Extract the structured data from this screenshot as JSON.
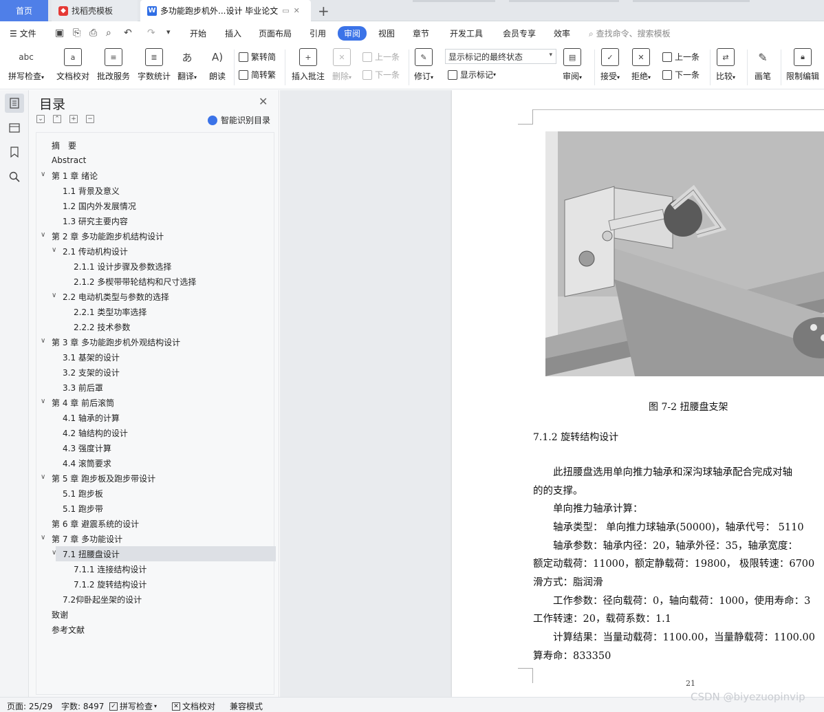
{
  "tabs": {
    "home": "首页",
    "template": "找稻壳模板",
    "document": "多功能跑步机外...设计 毕业论文",
    "add": "+"
  },
  "menu": {
    "file": "文件",
    "items": [
      "开始",
      "插入",
      "页面布局",
      "引用",
      "审阅",
      "视图",
      "章节",
      "开发工具",
      "会员专享",
      "效率"
    ],
    "active": "审阅",
    "search": "查找命令、搜索模板"
  },
  "ribbon": {
    "spell_check": "拼写检查",
    "doc_check": "文档校对",
    "revise_service": "批改服务",
    "word_count": "字数统计",
    "translate": "翻译",
    "read_aloud": "朗读",
    "to_traditional": "繁转简",
    "to_simplified": "简转繁",
    "insert_comment": "插入批注",
    "delete": "删除",
    "prev_comment": "上一条",
    "next_comment": "下一条",
    "track_changes": "修订",
    "markup_state": "显示标记的最终状态",
    "show_markup": "显示标记",
    "review": "审阅",
    "accept": "接受",
    "reject": "拒绝",
    "prev_change": "上一条",
    "next_change": "下一条",
    "compare": "比较",
    "pen": "画笔",
    "restrict_edit": "限制编辑"
  },
  "toc": {
    "title": "目录",
    "smart_btn": "智能识别目录",
    "items": [
      {
        "text": "摘　要",
        "level": 0,
        "chev": ""
      },
      {
        "text": "Abstract",
        "level": 0,
        "chev": ""
      },
      {
        "text": "第 1 章  绪论",
        "level": 0,
        "chev": "∨"
      },
      {
        "text": "1.1 背景及意义",
        "level": 1,
        "chev": ""
      },
      {
        "text": "1.2 国内外发展情况",
        "level": 1,
        "chev": ""
      },
      {
        "text": "1.3 研究主要内容",
        "level": 1,
        "chev": ""
      },
      {
        "text": "第 2 章  多功能跑步机结构设计",
        "level": 0,
        "chev": "∨"
      },
      {
        "text": "2.1  传动机构设计",
        "level": 1,
        "chev": "∨"
      },
      {
        "text": "2.1.1  设计步骤及参数选择",
        "level": 2,
        "chev": ""
      },
      {
        "text": "2.1.2 多楔带带轮结构和尺寸选择",
        "level": 2,
        "chev": ""
      },
      {
        "text": "2.2  电动机类型与参数的选择",
        "level": 1,
        "chev": "∨"
      },
      {
        "text": "2.2.1 类型功率选择",
        "level": 2,
        "chev": ""
      },
      {
        "text": "2.2.2 技术参数",
        "level": 2,
        "chev": ""
      },
      {
        "text": "第 3 章  多功能跑步机外观结构设计",
        "level": 0,
        "chev": "∨"
      },
      {
        "text": "3.1 基架的设计",
        "level": 1,
        "chev": ""
      },
      {
        "text": "3.2 支架的设计",
        "level": 1,
        "chev": ""
      },
      {
        "text": "3.3 前后罩",
        "level": 1,
        "chev": ""
      },
      {
        "text": "第 4 章  前后滚筒",
        "level": 0,
        "chev": "∨"
      },
      {
        "text": "4.1 轴承的计算",
        "level": 1,
        "chev": ""
      },
      {
        "text": "4.2 轴结构的设计",
        "level": 1,
        "chev": ""
      },
      {
        "text": "4.3 强度计算",
        "level": 1,
        "chev": ""
      },
      {
        "text": "4.4 滚筒要求",
        "level": 1,
        "chev": ""
      },
      {
        "text": "第 5 章  跑步板及跑步带设计",
        "level": 0,
        "chev": "∨"
      },
      {
        "text": "5.1 跑步板",
        "level": 1,
        "chev": ""
      },
      {
        "text": "5.1 跑步带",
        "level": 1,
        "chev": ""
      },
      {
        "text": "第 6 章  避震系统的设计",
        "level": 0,
        "chev": ""
      },
      {
        "text": "第 7 章  多功能设计",
        "level": 0,
        "chev": "∨"
      },
      {
        "text": "7.1 扭腰盘设计",
        "level": 1,
        "chev": "∨"
      },
      {
        "text": "7.1.1 连接结构设计",
        "level": 2,
        "chev": ""
      },
      {
        "text": "7.1.2 旋转结构设计",
        "level": 2,
        "chev": ""
      },
      {
        "text": "7.2仰卧起坐架的设计",
        "level": 1,
        "chev": ""
      },
      {
        "text": "致谢",
        "level": 0,
        "chev": ""
      },
      {
        "text": "参考文献",
        "level": 0,
        "chev": ""
      }
    ],
    "selected_index": 27
  },
  "document": {
    "caption": "图 7-2   扭腰盘支架",
    "heading": "7.1.2 旋转结构设计",
    "lines": [
      "　　此扭腰盘选用单向推力轴承和深沟球轴承配合完成对轴",
      "的的支撑。",
      "　　单向推力轴承计算：",
      "　　轴承类型：  单向推力球轴承(50000)，轴承代号：  5110",
      "　　轴承参数：轴承内径：20，轴承外径：35，轴承宽度：",
      "额定动载荷：11000，额定静载荷：19800，  极限转速：6700",
      "滑方式：脂润滑",
      "　　工作参数：径向载荷：0，轴向载荷：1000，使用寿命：3",
      "工作转速：20，载荷系数：1.1",
      "　　计算结果：当量动载荷：1100.00，当量静载荷：1100.00",
      "算寿命：833350"
    ],
    "page_number": "21"
  },
  "status": {
    "page": "页面: 25/29",
    "words": "字数: 8497",
    "spell": "拼写检查",
    "proof": "文档校对",
    "compat": "兼容模式"
  },
  "watermark": "CSDN @biyezuopinvip"
}
